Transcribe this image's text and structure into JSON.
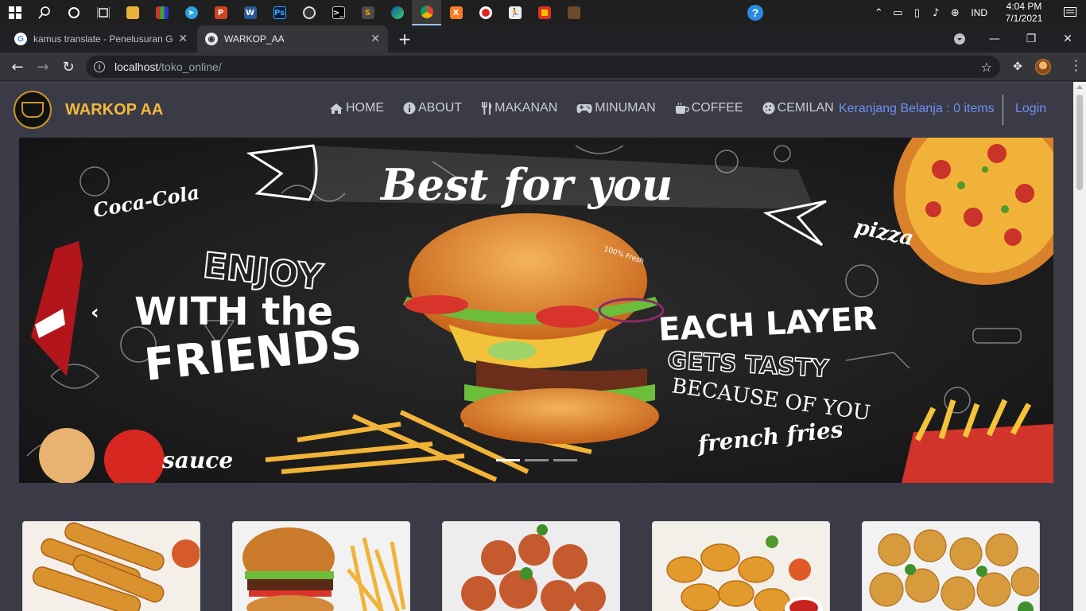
{
  "browser": {
    "tabs": [
      {
        "title": "kamus translate - Penelusuran Google",
        "active": false
      },
      {
        "title": "WARKOP_AA",
        "active": true
      }
    ],
    "url_host": "localhost",
    "url_path": "/toko_online/"
  },
  "taskbar": {
    "language": "IND",
    "time": "4:04 PM",
    "date": "7/1/2021"
  },
  "site": {
    "brand": "WARKOP AA",
    "nav": [
      {
        "label": "HOME",
        "icon": "home-icon"
      },
      {
        "label": "ABOUT",
        "icon": "info-icon"
      },
      {
        "label": "MAKANAN",
        "icon": "utensils-icon"
      },
      {
        "label": "MINUMAN",
        "icon": "gamepad-icon"
      },
      {
        "label": "COFFEE",
        "icon": "coffee-icon"
      },
      {
        "label": "CEMILAN",
        "icon": "cookie-icon"
      }
    ],
    "cart": "Keranjang Belanja : 0 items",
    "login": "Login",
    "colors": {
      "brand": "#f3b93a",
      "link": "#6f8ef0",
      "background": "#3b3b47"
    }
  },
  "banner": {
    "texts": {
      "headline": "Best for you",
      "enjoy": "ENJOY",
      "with_the": "WITH the",
      "friends": "FRIENDS",
      "each_layer": "EACH LAYER",
      "gets_tasty": "GETS TASTY",
      "because": "BECAUSE OF YOU",
      "coca_cola": "Coca-Cola",
      "pizza": "pizza",
      "sauce": "sauce",
      "french_fries": "french fries",
      "fresh": "100% Fresh"
    },
    "slides": 3,
    "active_slide": 1
  },
  "products": [
    {
      "name": "spring-rolls"
    },
    {
      "name": "burger-fries"
    },
    {
      "name": "meatballs"
    },
    {
      "name": "chicken-nuggets"
    },
    {
      "name": "fried-balls"
    }
  ]
}
